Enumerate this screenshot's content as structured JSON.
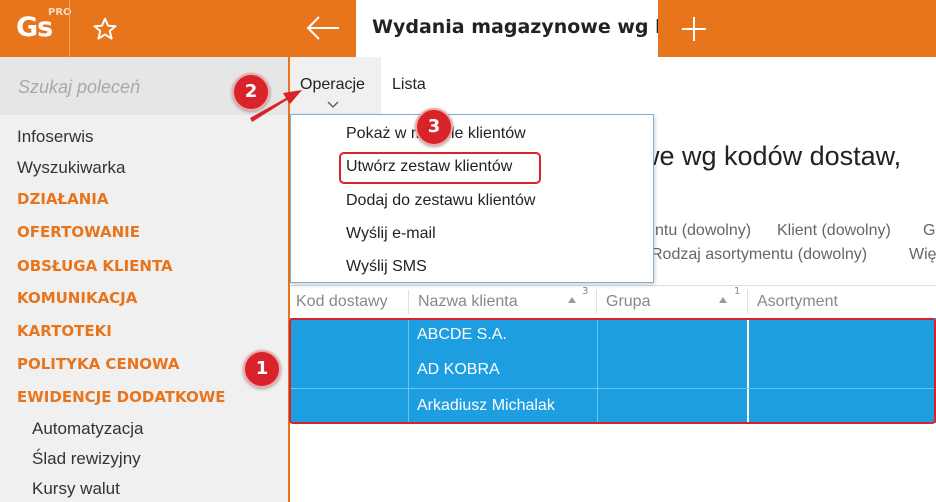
{
  "app": {
    "logo": "Gs",
    "logo_badge": "PRO",
    "tab_title": "Wydania magazynowe wg kodów dostaw, klienci"
  },
  "sidebar": {
    "search_placeholder": "Szukaj poleceń",
    "items": [
      {
        "label": "Infoserwis",
        "kind": "plain"
      },
      {
        "label": "Wyszukiwarka",
        "kind": "plain"
      },
      {
        "label": "DZIAŁANIA",
        "kind": "category"
      },
      {
        "label": "OFERTOWANIE",
        "kind": "category"
      },
      {
        "label": "OBSŁUGA KLIENTA",
        "kind": "category"
      },
      {
        "label": "KOMUNIKACJA",
        "kind": "category"
      },
      {
        "label": "KARTOTEKI",
        "kind": "category"
      },
      {
        "label": "POLITYKA CENOWA",
        "kind": "category"
      },
      {
        "label": "EWIDENCJE DODATKOWE",
        "kind": "category"
      },
      {
        "label": "Automatyzacja",
        "kind": "sub"
      },
      {
        "label": "Ślad rewizyjny",
        "kind": "sub"
      },
      {
        "label": "Kursy walut",
        "kind": "sub"
      }
    ]
  },
  "menubar": {
    "operacje": "Operacje",
    "lista": "Lista"
  },
  "dropdown": {
    "items": [
      "Pokaż w module klientów",
      "Utwórz zestaw klientów",
      "Dodaj do zestawu klientów",
      "Wyślij e-mail",
      "Wyślij SMS"
    ]
  },
  "page": {
    "title": "we wg kodów dostaw,",
    "filters_row1": [
      "ntu (dowolny)",
      "Klient (dowolny)",
      "G"
    ],
    "filters_row2": [
      "Rodzaj asortymentu (dowolny)",
      "Wię"
    ]
  },
  "grid": {
    "columns": [
      {
        "label": "Kod dostawy"
      },
      {
        "label": "Nazwa klienta",
        "sort_rank": "3"
      },
      {
        "label": "Grupa",
        "sort_rank": "1"
      },
      {
        "label": "Asortyment"
      }
    ],
    "rows": [
      "ABCDE S.A.",
      "AD KOBRA",
      "Arkadiusz Michalak"
    ]
  },
  "callouts": [
    "1",
    "2",
    "3"
  ],
  "colors": {
    "accent": "#e8741c",
    "selection": "#1d9ee0",
    "callout": "#d9232a"
  }
}
